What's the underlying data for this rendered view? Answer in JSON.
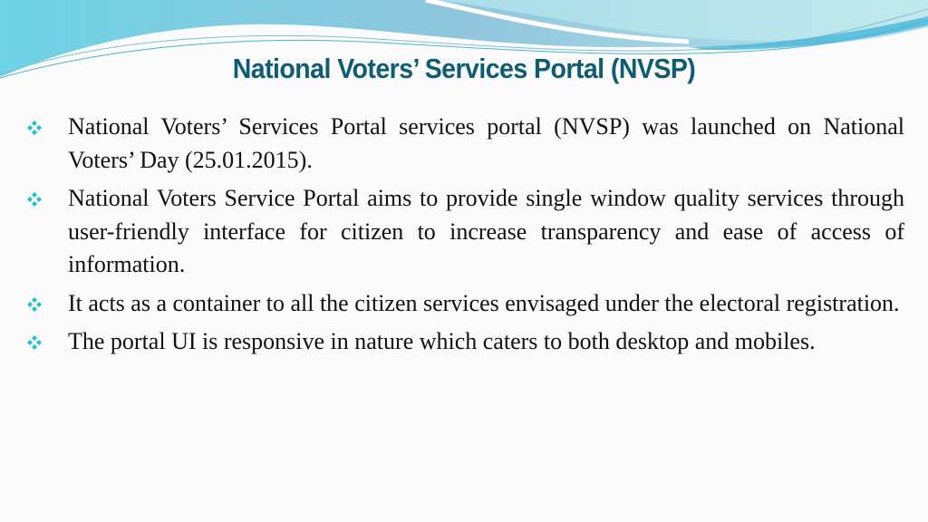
{
  "slide": {
    "title": "National Voters’ Services Portal (NVSP)",
    "bullet_icon": "diamond-cluster-icon",
    "accent_color": "#1fc0d0",
    "title_color": "#0e5c73",
    "bullets": [
      {
        "text": "National Voters’ Services Portal services portal (NVSP) was launched on National Voters’ Day (25.01.2015)."
      },
      {
        "text": "National Voters Service Portal aims to provide single window quality services through user-friendly interface for citizen to increase transparency and ease of access of information."
      },
      {
        "text": "It acts as a container to all the citizen services envisaged under the electoral registration."
      },
      {
        "text": "The portal UI is responsive in nature which caters to both desktop and mobiles."
      }
    ]
  }
}
